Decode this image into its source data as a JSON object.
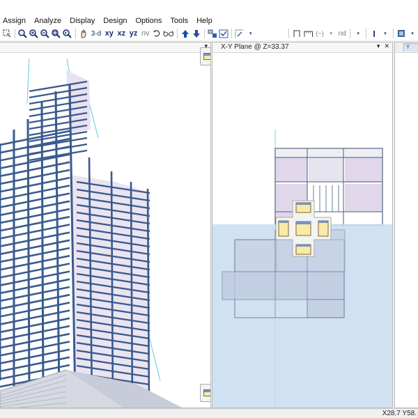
{
  "menu": {
    "items": [
      "Assign",
      "Analyze",
      "Display",
      "Design",
      "Options",
      "Tools",
      "Help"
    ]
  },
  "toolbar": {
    "view_3d": "3-d",
    "view_xy": "xy",
    "view_xz": "xz",
    "view_yz": "yz",
    "view_nv": "nv",
    "nd_label": "nd",
    "icons": [
      "zoom-window-icon",
      "zoom-in-icon",
      "zoom-out-icon",
      "zoom-extents-icon",
      "zoom-previous-icon",
      "pan-icon",
      "rotate-icon",
      "glasses-icon",
      "move-up-icon",
      "move-down-icon",
      "select-icon",
      "check-icon",
      "assign-grid-icon",
      "line-icon",
      "cursor-icon",
      "box-icon"
    ]
  },
  "views": {
    "plan_title": "X-Y Plane @ Z=33.37"
  },
  "status": {
    "coordinates": "X28.7  Y58."
  },
  "colors": {
    "frame_blue": "#3a5a8c",
    "grid_cyan": "#5cc9e6",
    "slab_lilac": "#d8cde6",
    "dock_highlight": "#c8dcf0"
  }
}
